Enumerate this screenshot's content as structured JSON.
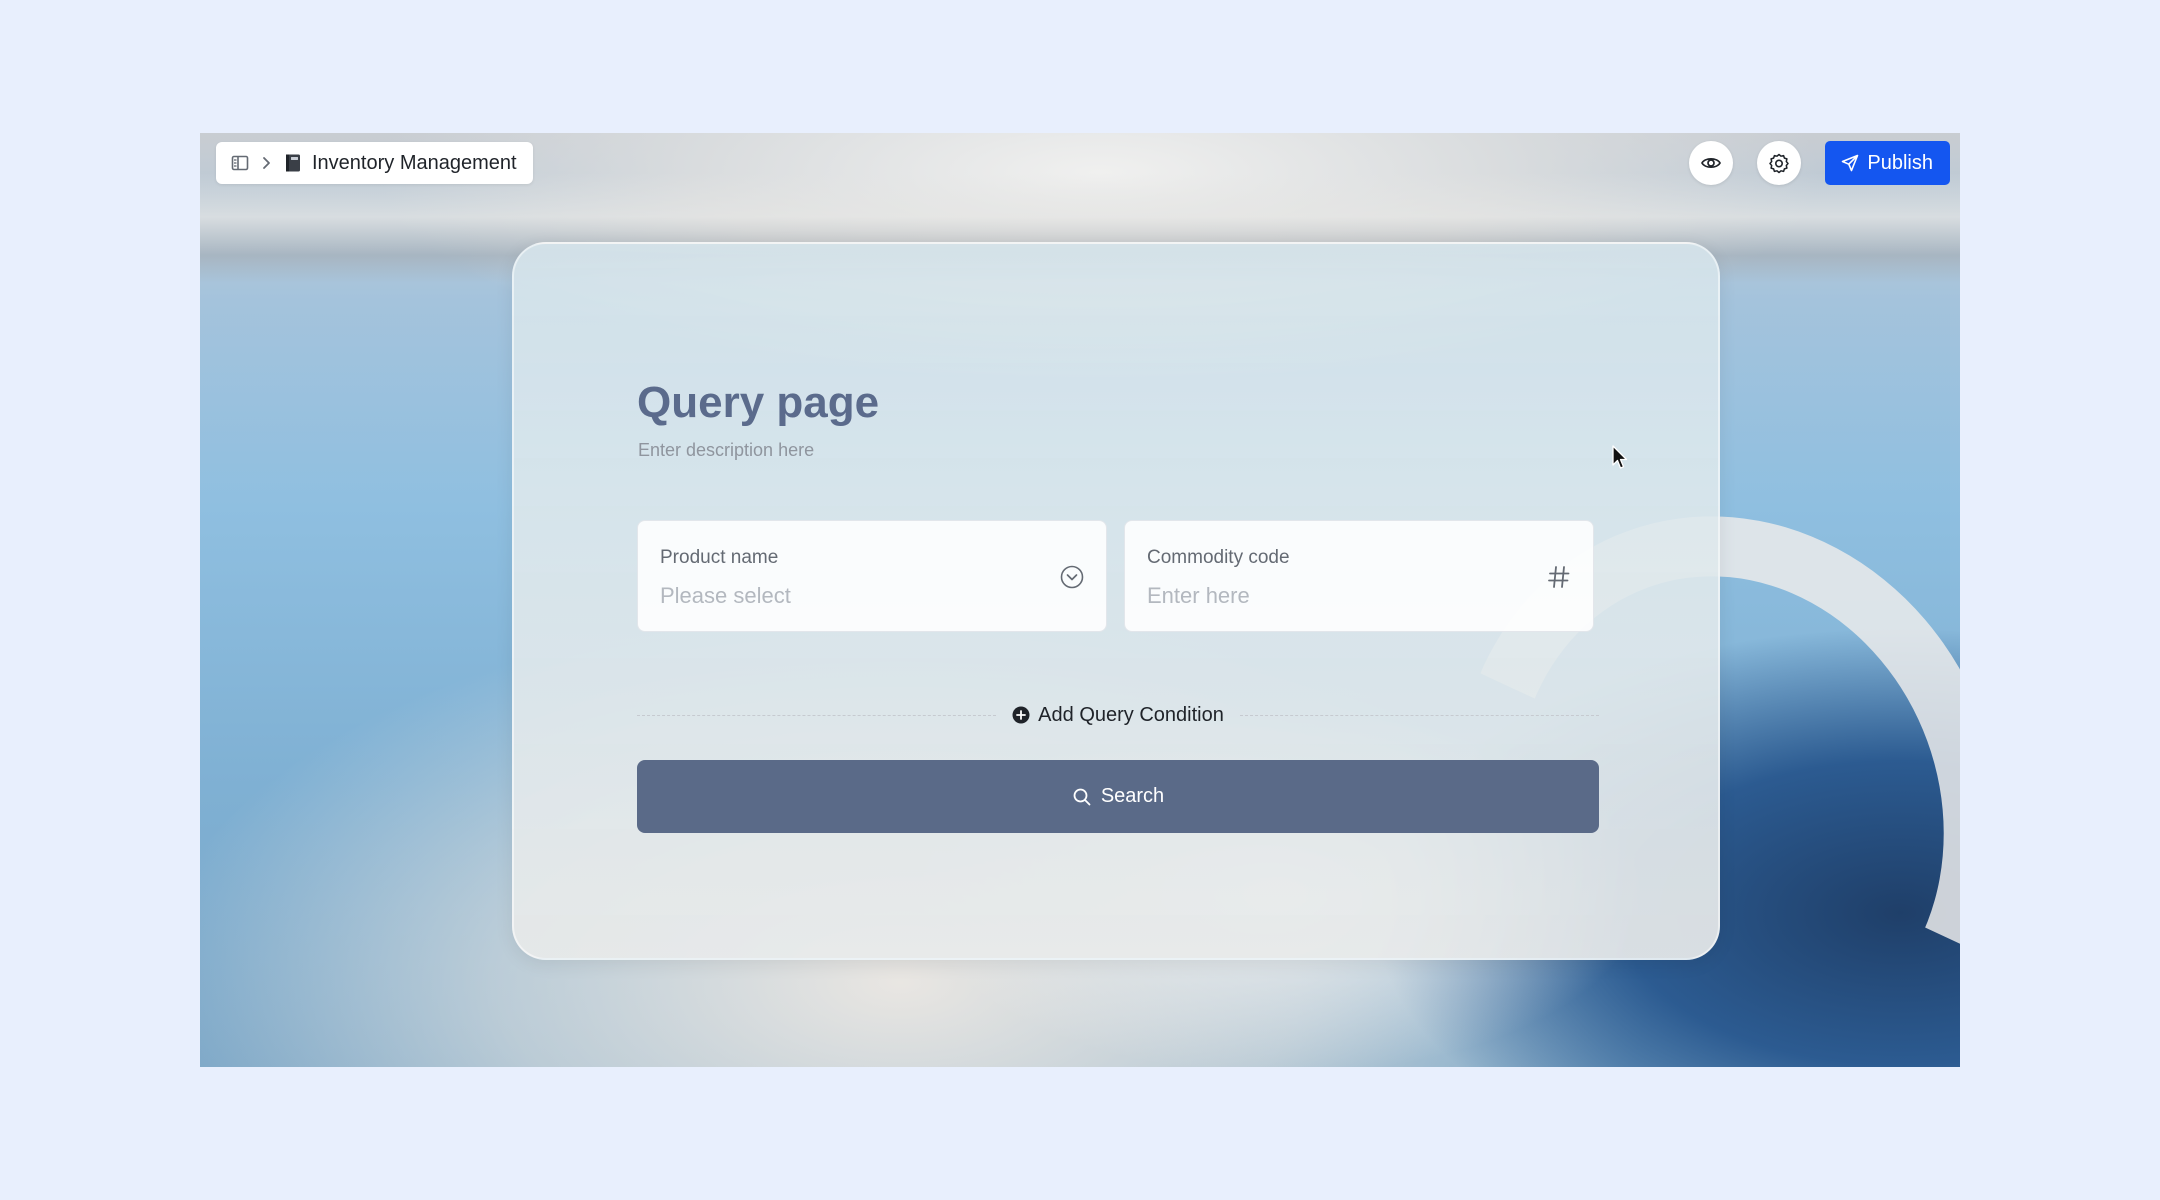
{
  "header": {
    "app_title": "Inventory Management",
    "icons": [
      "sidebar-toggle-icon",
      "chevron-right-icon",
      "book-icon",
      "eye-icon",
      "gear-icon",
      "send-icon"
    ],
    "publish_label": "Publish"
  },
  "page": {
    "title": "Query page",
    "description": "Enter description here"
  },
  "fields": [
    {
      "label": "Product name",
      "placeholder": "Please select",
      "icon": "chevron-down-circle-icon"
    },
    {
      "label": "Commodity code",
      "placeholder": "Enter here",
      "icon": "hash-icon"
    }
  ],
  "add_condition_label": "Add Query Condition",
  "search_label": "Search",
  "colors": {
    "accent": "#1456f0",
    "search_button": "#5a6a88",
    "title": "#5b6b8c",
    "page_background": "#e8effd"
  }
}
